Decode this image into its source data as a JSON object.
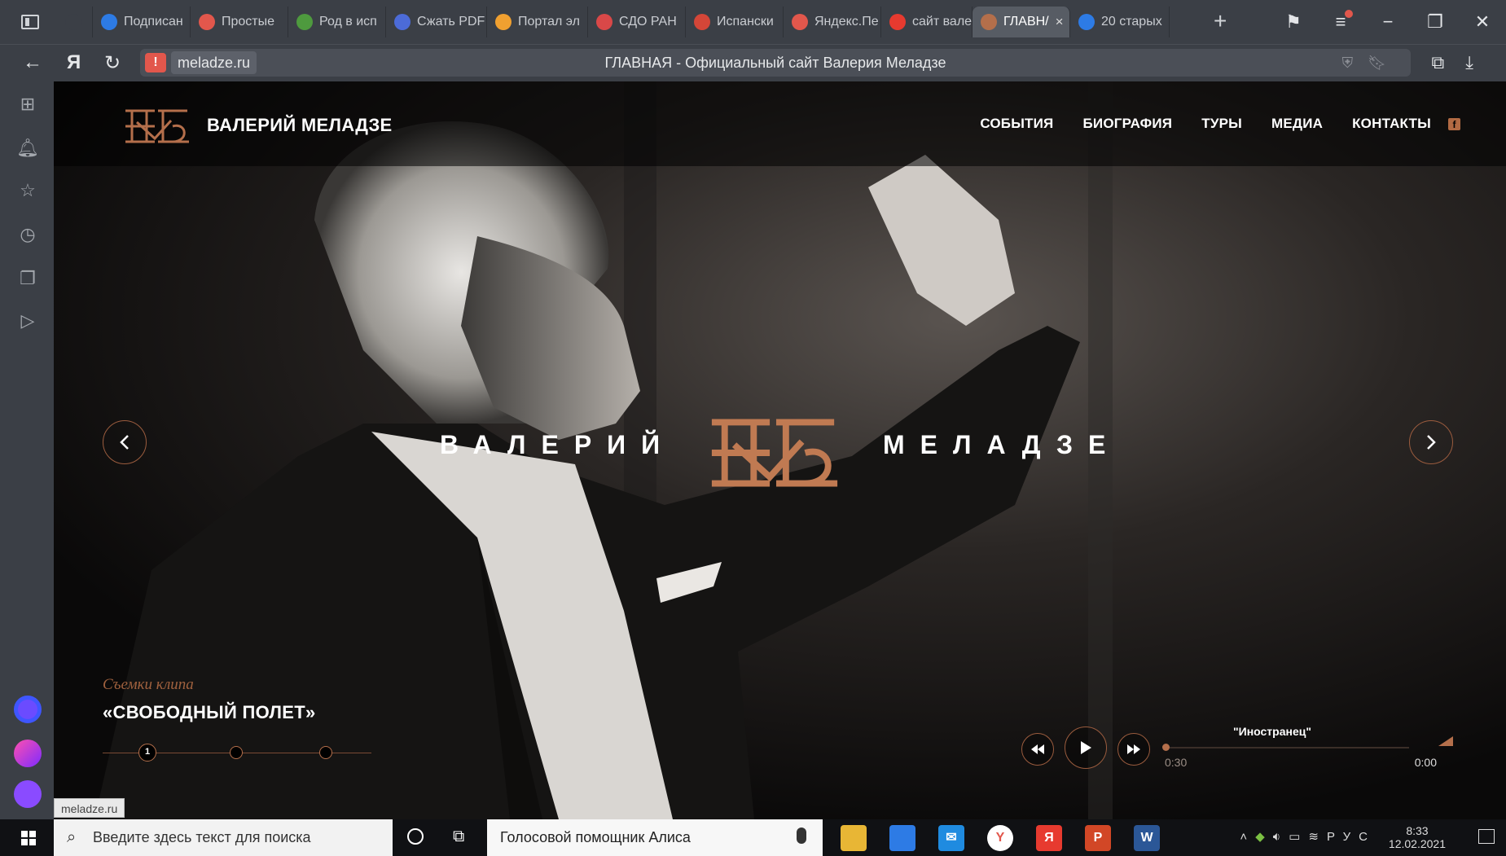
{
  "browser": {
    "tabs": [
      {
        "label": "",
        "fav": "speaker-icon",
        "color": "#3b3f46"
      },
      {
        "label": "Подписан",
        "fav": "edge-icon",
        "color": "#2d7be5"
      },
      {
        "label": "Простые",
        "fav": "spain-flag-icon",
        "color": "#e2574c"
      },
      {
        "label": "Род в исп",
        "fav": "tree-icon",
        "color": "#4e9a3e"
      },
      {
        "label": "Сжать PDF",
        "fav": "w-icon",
        "color": "#4c6bd8"
      },
      {
        "label": "Портал эл",
        "fav": "portal-icon",
        "color": "#f0a030"
      },
      {
        "label": "СДО РАН",
        "fav": "ranepa-icon",
        "color": "#d94848"
      },
      {
        "label": "Испански",
        "fav": "gmail-icon",
        "color": "#d44638"
      },
      {
        "label": "Яндекс.Пе",
        "fav": "yandex-translate-icon",
        "color": "#e2574c"
      },
      {
        "label": "сайт вале",
        "fav": "yandex-icon",
        "color": "#e73a2f"
      },
      {
        "label": "ГЛАВН/",
        "fav": "meladze-icon",
        "color": "#b46f4b",
        "active": true
      },
      {
        "label": "20 старых",
        "fav": "ip-icon",
        "color": "#2d7be5"
      }
    ],
    "new_tab": "+",
    "domain": "meladze.ru",
    "page_title": "ГЛАВНАЯ - Официальный сайт Валерия Меладзе",
    "back_glyph": "←",
    "yandex_glyph": "Я",
    "reload_glyph": "↻",
    "warning_glyph": "!"
  },
  "site": {
    "brand": "ВАЛЕРИЙ МЕЛАДЗЕ",
    "menu": [
      "СОБЫТИЯ",
      "БИОГРАФИЯ",
      "ТУРЫ",
      "МЕДИА",
      "КОНТАКТЫ"
    ],
    "facebook_glyph": "f",
    "tagline_left": "ВАЛЕРИЙ",
    "tagline_right": "МЕЛАДЗЕ",
    "accent": "#b46f4b",
    "slide": {
      "subtitle": "Съемки клипа",
      "title": "«СВОБОДНЫЙ ПОЛЕТ»",
      "active_dot": "1"
    },
    "player": {
      "track": "\"Иностранец\"",
      "current_time": "0:30",
      "duration": "0:00"
    },
    "status_url": "meladze.ru"
  },
  "taskbar": {
    "search_placeholder": "Введите здесь текст для поиска",
    "alice_label": "Голосовой помощник Алиса",
    "lang": "РУС",
    "time": "8:33",
    "date": "12.02.2021"
  }
}
